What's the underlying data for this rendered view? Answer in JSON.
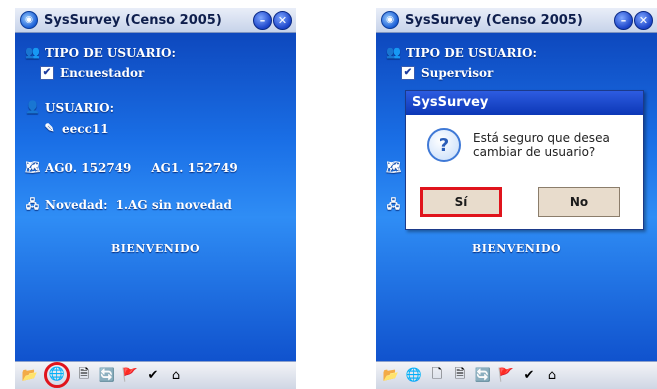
{
  "left_screen": {
    "title": "SysSurvey (Censo 2005)",
    "user_type_label": "TIPO DE USUARIO:",
    "user_type_value": "Encuestador",
    "user_label": "USUARIO:",
    "user_value": "eecc11",
    "ag0": "AG0. 152749",
    "ag1": "AG1. 152749",
    "novedad_label": "Novedad:",
    "novedad_value": "1.AG sin novedad",
    "welcome": "BIENVENIDO"
  },
  "right_screen": {
    "title": "SysSurvey (Censo 2005)",
    "user_type_label": "TIPO DE USUARIO:",
    "user_type_value": "Supervisor",
    "welcome": "BIENVENIDO",
    "dialog": {
      "title": "SysSurvey",
      "message": "Está seguro que desea cambiar de usuario?",
      "yes_label": "Sí",
      "no_label": "No"
    }
  },
  "icons": {
    "checkbox_mark": "✔",
    "question_mark": "?",
    "minimize_glyph": "–",
    "close_glyph": "✕"
  },
  "colors": {
    "screen_blue": "#1a6fe6",
    "highlight_red": "#e0141c",
    "dialog_title_blue": "#0c37b6"
  }
}
